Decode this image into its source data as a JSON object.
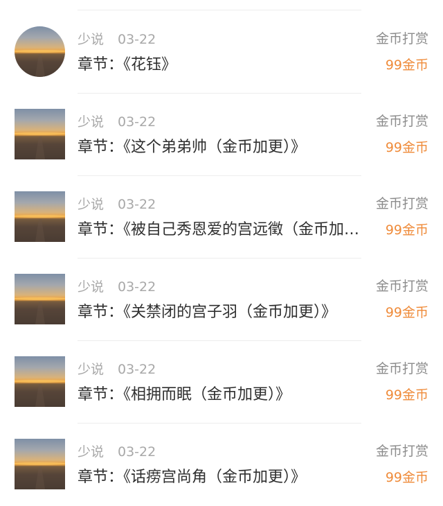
{
  "rewards": [
    {
      "user": "少说",
      "date": "03-22",
      "chapter": "章节：《花钰》",
      "reward_type": "金币打赏",
      "amount": "99金币"
    },
    {
      "user": "少说",
      "date": "03-22",
      "chapter": "章节：《这个弟弟帅（金币加更）》",
      "reward_type": "金币打赏",
      "amount": "99金币"
    },
    {
      "user": "少说",
      "date": "03-22",
      "chapter": "章节：《被自己秀恩爱的宫远徵（金币加更）》",
      "reward_type": "金币打赏",
      "amount": "99金币"
    },
    {
      "user": "少说",
      "date": "03-22",
      "chapter": "章节：《关禁闭的宫子羽（金币加更）》",
      "reward_type": "金币打赏",
      "amount": "99金币"
    },
    {
      "user": "少说",
      "date": "03-22",
      "chapter": "章节：《相拥而眠（金币加更）》",
      "reward_type": "金币打赏",
      "amount": "99金币"
    },
    {
      "user": "少说",
      "date": "03-22",
      "chapter": "章节：《话痨宫尚角（金币加更）》",
      "reward_type": "金币打赏",
      "amount": "99金币"
    }
  ],
  "colors": {
    "meta_gray": "#a8a8a8",
    "chapter_text": "#2f2f2f",
    "reward_type_gray": "#8c8c8c",
    "amount_orange": "#ef8b3a",
    "divider": "#ededed"
  },
  "icons": {
    "avatar": "sunset-photo-avatar"
  }
}
